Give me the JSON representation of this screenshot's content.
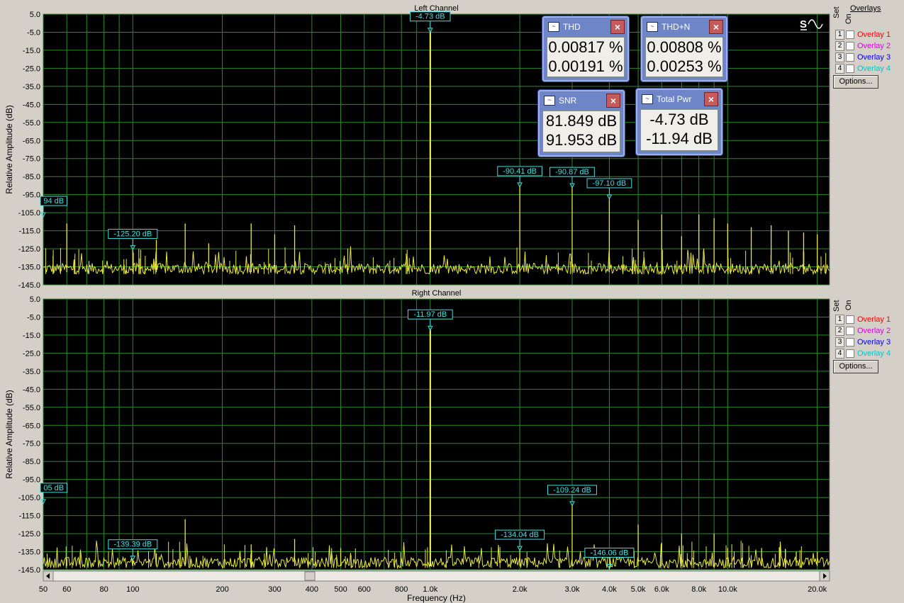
{
  "colors": {
    "background": "#d4d0c8",
    "plot_bg": "#000000",
    "grid": "#2a8a2a",
    "trace": "#e8e840",
    "marker": "#40e0e0"
  },
  "ylabel": "Relative Amplitude (dB)",
  "xlabel": "Frequency (Hz)",
  "overlays_title": "Overlays",
  "set_label": "Set",
  "on_label": "On",
  "options_label": "Options...",
  "overlays": [
    {
      "num": "1",
      "label": "Overlay 1",
      "color": "#ff0000"
    },
    {
      "num": "2",
      "label": "Overlay 2",
      "color": "#e000e0"
    },
    {
      "num": "3",
      "label": "Overlay 3",
      "color": "#0000ff"
    },
    {
      "num": "4",
      "label": "Overlay 4",
      "color": "#00e0e0"
    }
  ],
  "meters": {
    "thd": {
      "title": "THD",
      "v1": "0.00817 %",
      "v2": "0.00191 %"
    },
    "thdn": {
      "title": "THD+N",
      "v1": "0.00808 %",
      "v2": "0.00253 %"
    },
    "snr": {
      "title": "SNR",
      "v1": "81.849 dB",
      "v2": "91.953 dB"
    },
    "pwr": {
      "title": "Total Pwr",
      "v1": "-4.73 dB",
      "v2": "-11.94 dB"
    }
  },
  "chart_data": [
    {
      "type": "line",
      "title": "Left Channel",
      "xscale": "log",
      "xlim": [
        50,
        22000
      ],
      "ylim": [
        -145,
        5
      ],
      "yticks": [
        5,
        -5,
        -15,
        -25,
        -35,
        -45,
        -55,
        -65,
        -75,
        -85,
        -95,
        -105,
        -115,
        -125,
        -135,
        -145
      ],
      "ytick_labels": [
        "5.0",
        "-5.0",
        "-15.0",
        "-25.0",
        "-35.0",
        "-45.0",
        "-55.0",
        "-65.0",
        "-75.0",
        "-85.0",
        "-95.0",
        "-105.0",
        "-115.0",
        "-125.0",
        "-135.0",
        "-145.0"
      ],
      "noise_floor": -136,
      "peaks": [
        {
          "x": 60,
          "y": -111
        },
        {
          "x": 100,
          "y": -125.2
        },
        {
          "x": 120,
          "y": -120
        },
        {
          "x": 150,
          "y": -111
        },
        {
          "x": 180,
          "y": -122
        },
        {
          "x": 250,
          "y": -111
        },
        {
          "x": 300,
          "y": -117
        },
        {
          "x": 350,
          "y": -112
        },
        {
          "x": 1000,
          "y": -4.7
        },
        {
          "x": 2000,
          "y": -90.41
        },
        {
          "x": 3000,
          "y": -90.87
        },
        {
          "x": 4000,
          "y": -97.1
        },
        {
          "x": 5000,
          "y": -109
        },
        {
          "x": 6000,
          "y": -106
        },
        {
          "x": 7000,
          "y": -118
        },
        {
          "x": 8000,
          "y": -106
        },
        {
          "x": 9000,
          "y": -108
        },
        {
          "x": 10000,
          "y": -111
        },
        {
          "x": 12000,
          "y": -113
        },
        {
          "x": 14000,
          "y": -112
        },
        {
          "x": 16000,
          "y": -115
        },
        {
          "x": 18000,
          "y": -116
        },
        {
          "x": 20000,
          "y": -117
        }
      ],
      "markers": [
        {
          "x": 50,
          "y": -106.94,
          "label": "94 dB"
        },
        {
          "x": 100,
          "y": -125.2,
          "label": "-125.20 dB"
        },
        {
          "x": 1000,
          "y": -4.7,
          "label": "-4.73 dB"
        },
        {
          "x": 2000,
          "y": -90.41,
          "label": "-90.41 dB"
        },
        {
          "x": 3000,
          "y": -90.87,
          "label": "-90.87 dB"
        },
        {
          "x": 4000,
          "y": -97.1,
          "label": "-97.10 dB"
        }
      ]
    },
    {
      "type": "line",
      "title": "Right Channel",
      "xscale": "log",
      "xlim": [
        50,
        22000
      ],
      "ylim": [
        -145,
        5
      ],
      "yticks": [
        5,
        -5,
        -15,
        -25,
        -35,
        -45,
        -55,
        -65,
        -75,
        -85,
        -95,
        -105,
        -115,
        -125,
        -135,
        -145
      ],
      "ytick_labels": [
        "5.0",
        "-5.0",
        "-15.0",
        "-25.0",
        "-35.0",
        "-45.0",
        "-55.0",
        "-65.0",
        "-75.0",
        "-85.0",
        "-95.0",
        "-105.0",
        "-115.0",
        "-125.0",
        "-135.0",
        "-145.0"
      ],
      "noise_floor": -141,
      "peaks": [
        {
          "x": 60,
          "y": -139
        },
        {
          "x": 100,
          "y": -139.39
        },
        {
          "x": 120,
          "y": -136
        },
        {
          "x": 150,
          "y": -117
        },
        {
          "x": 250,
          "y": -131
        },
        {
          "x": 350,
          "y": -128
        },
        {
          "x": 500,
          "y": -133
        },
        {
          "x": 1000,
          "y": -11.97
        },
        {
          "x": 2000,
          "y": -134.04
        },
        {
          "x": 3000,
          "y": -109.24
        },
        {
          "x": 4000,
          "y": -146.06
        },
        {
          "x": 5000,
          "y": -120
        },
        {
          "x": 6000,
          "y": -130
        },
        {
          "x": 7000,
          "y": -125
        },
        {
          "x": 9000,
          "y": -125
        },
        {
          "x": 10000,
          "y": -133
        },
        {
          "x": 13000,
          "y": -133
        },
        {
          "x": 15000,
          "y": -133
        },
        {
          "x": 17000,
          "y": -135
        },
        {
          "x": 20000,
          "y": -135
        }
      ],
      "markers": [
        {
          "x": 50,
          "y": -108.05,
          "label": "05 dB"
        },
        {
          "x": 100,
          "y": -139.39,
          "label": "-139.39 dB"
        },
        {
          "x": 1000,
          "y": -11.97,
          "label": "-11.97 dB"
        },
        {
          "x": 2000,
          "y": -134.04,
          "label": "-134.04 dB"
        },
        {
          "x": 3000,
          "y": -109.24,
          "label": "-109.24 dB"
        },
        {
          "x": 4000,
          "y": -146.06,
          "label": "-146.06 dB"
        }
      ]
    }
  ],
  "xticks": [
    50,
    60,
    80,
    100,
    200,
    300,
    400,
    500,
    600,
    800,
    1000,
    2000,
    3000,
    4000,
    5000,
    6000,
    8000,
    10000,
    20000
  ],
  "xtick_labels": [
    "50",
    "60",
    "80",
    "100",
    "200",
    "300",
    "400",
    "500",
    "600",
    "800",
    "1.0k",
    "2.0k",
    "3.0k",
    "4.0k",
    "5.0k",
    "6.0k",
    "8.0k",
    "10.0k",
    "20.0k"
  ]
}
